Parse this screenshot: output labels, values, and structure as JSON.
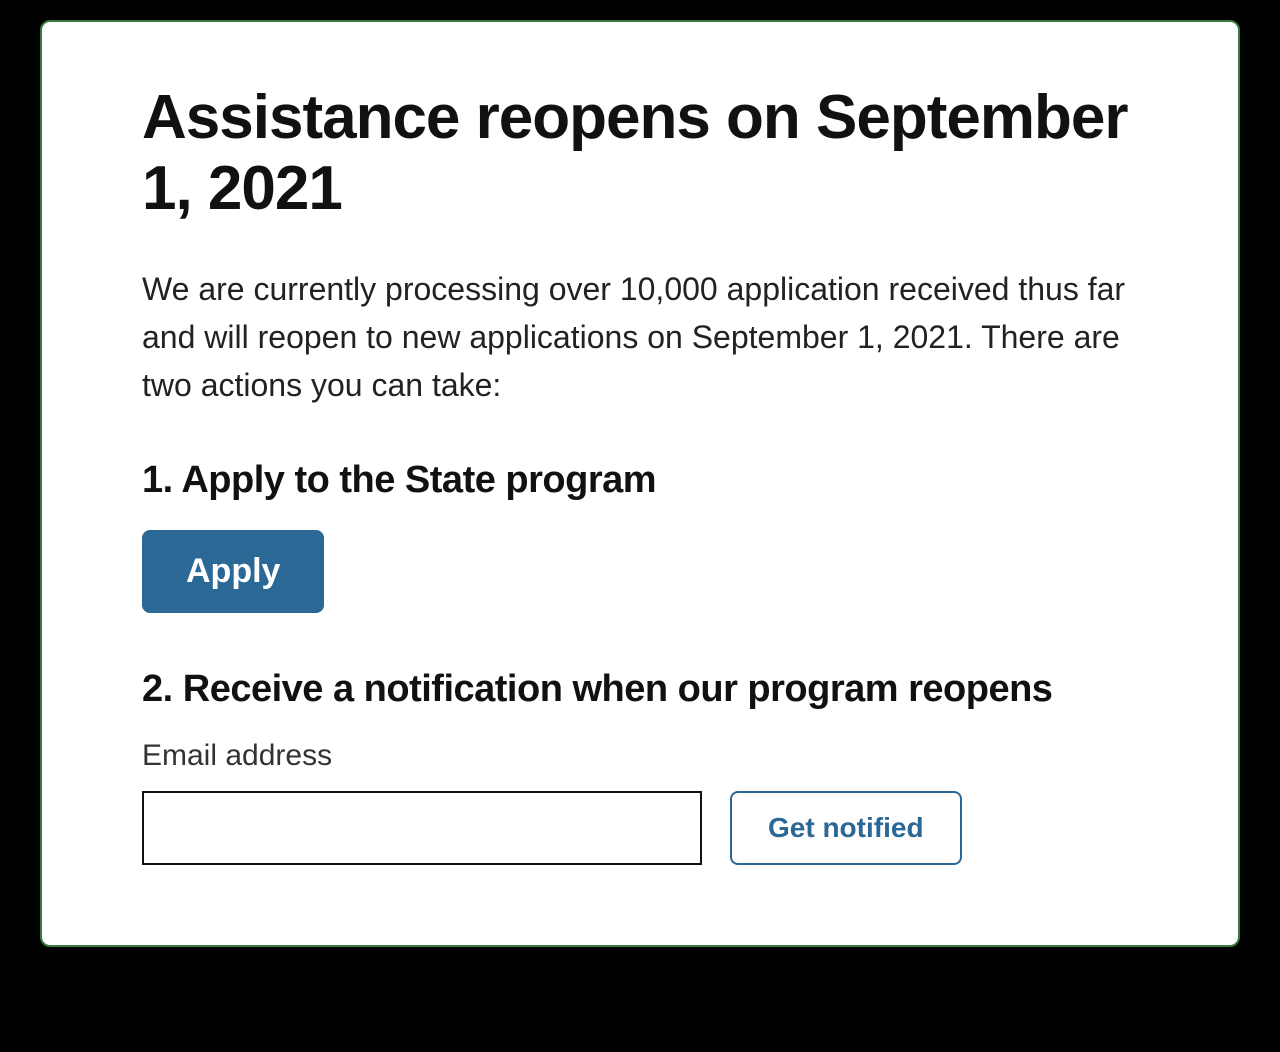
{
  "title": "Assistance reopens on September 1, 2021",
  "intro": "We are currently processing over 10,000 application received thus far and will reopen to new applications on September 1, 2021. There are two actions you can take:",
  "section1": {
    "heading": "1. Apply to the State program",
    "button_label": "Apply"
  },
  "section2": {
    "heading": "2. Receive a notification when our program reopens",
    "email_label": "Email address",
    "email_value": "",
    "notify_button_label": "Get notified"
  }
}
